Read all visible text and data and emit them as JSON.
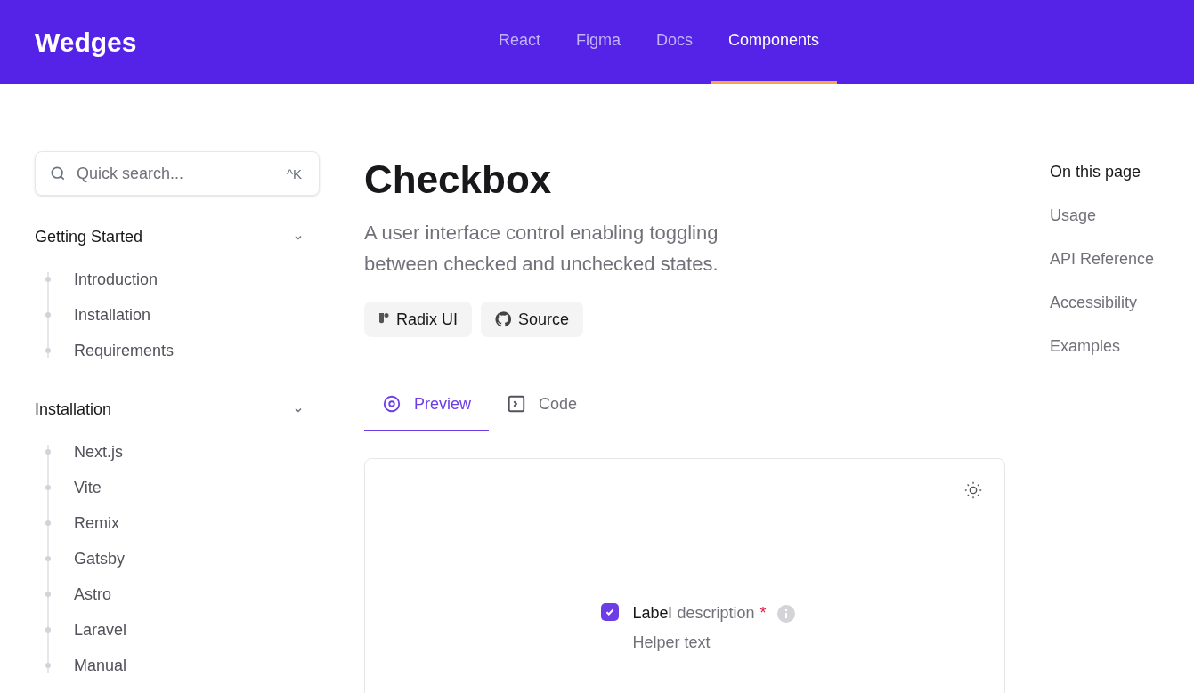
{
  "header": {
    "logo": "Wedges",
    "nav": [
      {
        "label": "React",
        "selected": false
      },
      {
        "label": "Figma",
        "selected": false
      },
      {
        "label": "Docs",
        "selected": false
      },
      {
        "label": "Components",
        "selected": true
      }
    ]
  },
  "sidebar": {
    "search": {
      "placeholder": "Quick search...",
      "shortcut": "^K"
    },
    "sections": [
      {
        "title": "Getting Started",
        "expanded": true,
        "children": [
          {
            "label": "Introduction"
          },
          {
            "label": "Installation"
          },
          {
            "label": "Requirements"
          }
        ]
      },
      {
        "title": "Installation",
        "expanded": true,
        "children": [
          {
            "label": "Next.js"
          },
          {
            "label": "Vite"
          },
          {
            "label": "Remix"
          },
          {
            "label": "Gatsby"
          },
          {
            "label": "Astro"
          },
          {
            "label": "Laravel"
          },
          {
            "label": "Manual"
          }
        ]
      }
    ]
  },
  "main": {
    "title": "Checkbox",
    "description": "A user interface control enabling toggling between checked and unchecked states.",
    "links": [
      {
        "kind": "radix",
        "label": "Radix UI"
      },
      {
        "kind": "github",
        "label": "Source"
      }
    ],
    "tabs": [
      {
        "kind": "preview",
        "label": "Preview",
        "selected": true
      },
      {
        "kind": "code",
        "label": "Code",
        "selected": false
      }
    ],
    "preview": {
      "checkbox": {
        "checked": true,
        "label": "Label",
        "description": "description",
        "required_mark": "*",
        "helper": "Helper text"
      }
    }
  },
  "toc": {
    "title": "On this page",
    "items": [
      {
        "label": "Usage"
      },
      {
        "label": "API Reference"
      },
      {
        "label": "Accessibility"
      },
      {
        "label": "Examples"
      }
    ]
  }
}
